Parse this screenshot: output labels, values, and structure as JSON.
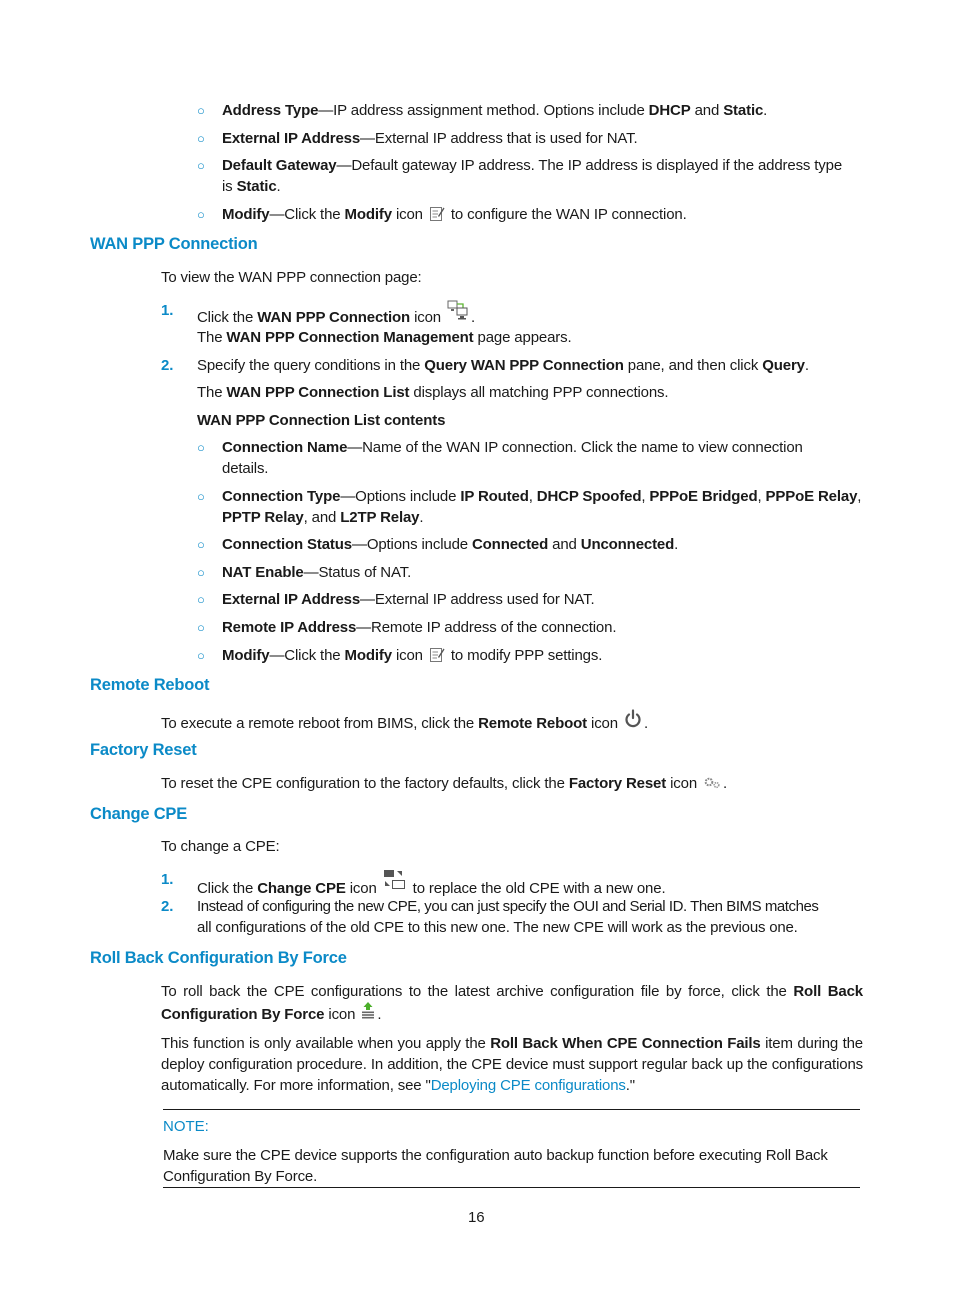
{
  "wan_ip_list_tail": [
    {
      "term": "Address Type",
      "desc_parts": [
        "IP address assignment method. Options include ",
        {
          "b": "DHCP"
        },
        " and ",
        {
          "b": "Static"
        },
        "."
      ]
    },
    {
      "term": "External IP Address",
      "desc": "External IP address that is used for NAT."
    },
    {
      "term": "Default Gateway",
      "desc_line1": "Default gateway IP address. The IP address is displayed if the address type",
      "desc_line2_pre": "is ",
      "desc_line2_bold": "Static",
      "desc_line2_post": "."
    },
    {
      "term": "Modify",
      "pre": "Click the ",
      "bold": "Modify",
      "mid": " icon ",
      "icon": "modify-icon",
      "post": " to configure the WAN IP connection."
    }
  ],
  "sections": {
    "wan_ppp": {
      "heading": "WAN PPP Connection",
      "intro": "To view the WAN PPP connection page:",
      "steps": [
        {
          "num": "1.",
          "pre": "Click the ",
          "bold": "WAN PPP Connection",
          "post": " icon",
          "icon": "wan-ppp-connection-icon",
          "after": ".",
          "sub_pre": "The ",
          "sub_bold": "WAN PPP Connection Management",
          "sub_post": " page appears."
        },
        {
          "num": "2.",
          "pre": "Specify the query conditions in the ",
          "bold": "Query WAN PPP Connection",
          "mid": " pane, and then click ",
          "bold2": "Query",
          "post": ".",
          "sub_pre": "The ",
          "sub_bold": "WAN PPP Connection List",
          "sub_post": " displays all matching PPP connections."
        }
      ],
      "list_title": "WAN PPP Connection List contents",
      "items": [
        {
          "term": "Connection Name",
          "desc_line1": "Name of the WAN IP connection. Click the name to view connection",
          "desc_line2": "details."
        },
        {
          "term": "Connection Type",
          "line1": [
            "Options include ",
            {
              "b": "IP Routed"
            },
            ", ",
            {
              "b": "DHCP Spoofed"
            },
            ", ",
            {
              "b": "PPPoE Bridged"
            },
            ", ",
            {
              "b": "PPPoE Relay"
            },
            ","
          ],
          "line2": [
            {
              "b": "PPTP Relay"
            },
            ", and ",
            {
              "b": "L2TP Relay"
            },
            "."
          ]
        },
        {
          "term": "Connection Status",
          "parts": [
            "Options include ",
            {
              "b": "Connected"
            },
            " and ",
            {
              "b": "Unconnected"
            },
            "."
          ]
        },
        {
          "term": "NAT Enable",
          "desc": "Status of NAT."
        },
        {
          "term": "External IP Address",
          "desc": "External IP address used for NAT."
        },
        {
          "term": "Remote IP Address",
          "desc": "Remote IP address of the connection."
        },
        {
          "term": "Modify",
          "pre": "Click the ",
          "bold": "Modify",
          "mid": " icon ",
          "icon": "modify-icon",
          "post": " to modify PPP settings."
        }
      ]
    },
    "remote_reboot": {
      "heading": "Remote Reboot",
      "pre": "To execute a remote reboot from BIMS, click the ",
      "bold": "Remote Reboot",
      "post": " icon ",
      "icon": "power-icon",
      "after": "."
    },
    "factory_reset": {
      "heading": "Factory Reset",
      "pre": "To reset the CPE configuration to the factory defaults, click the ",
      "bold": "Factory Reset",
      "post": " icon ",
      "icon": "gears-icon",
      "after": "."
    },
    "change_cpe": {
      "heading": "Change CPE",
      "intro": "To change a CPE:",
      "steps": [
        {
          "num": "1.",
          "pre": "Click the ",
          "bold": "Change CPE",
          "post": " icon ",
          "icon": "change-cpe-icon",
          "after": " to replace the old CPE with a new one."
        },
        {
          "num": "2.",
          "line1": "Instead of configuring the new CPE, you can just specify the OUI and Serial ID. Then BIMS matches",
          "line2": "all configurations of the old CPE to this new one. The new CPE will work as the previous one."
        }
      ]
    },
    "roll_back": {
      "heading": "Roll Back Configuration By Force",
      "p1_pre": "To roll back the CPE configurations to the latest archive configuration file by force, click the ",
      "p1_bold": "Roll Back Configuration By Force",
      "p1_post": " icon ",
      "p1_icon": "rollback-icon",
      "p1_after": ".",
      "p2_pre": "This function is only available when you apply the ",
      "p2_bold": "Roll Back When CPE Connection Fails",
      "p2_mid": " item during the deploy configuration procedure. In addition, the CPE device must support regular back up the configurations automatically. For more information, see \"",
      "p2_link": "Deploying CPE configurations",
      "p2_post": ".\""
    }
  },
  "note": {
    "label": "NOTE:",
    "text": "Make sure the CPE device supports the configuration auto backup function before executing Roll Back Configuration By Force."
  },
  "page_number": "16",
  "colors": {
    "accent": "#0b8ac7",
    "text": "#1a1a1a"
  }
}
